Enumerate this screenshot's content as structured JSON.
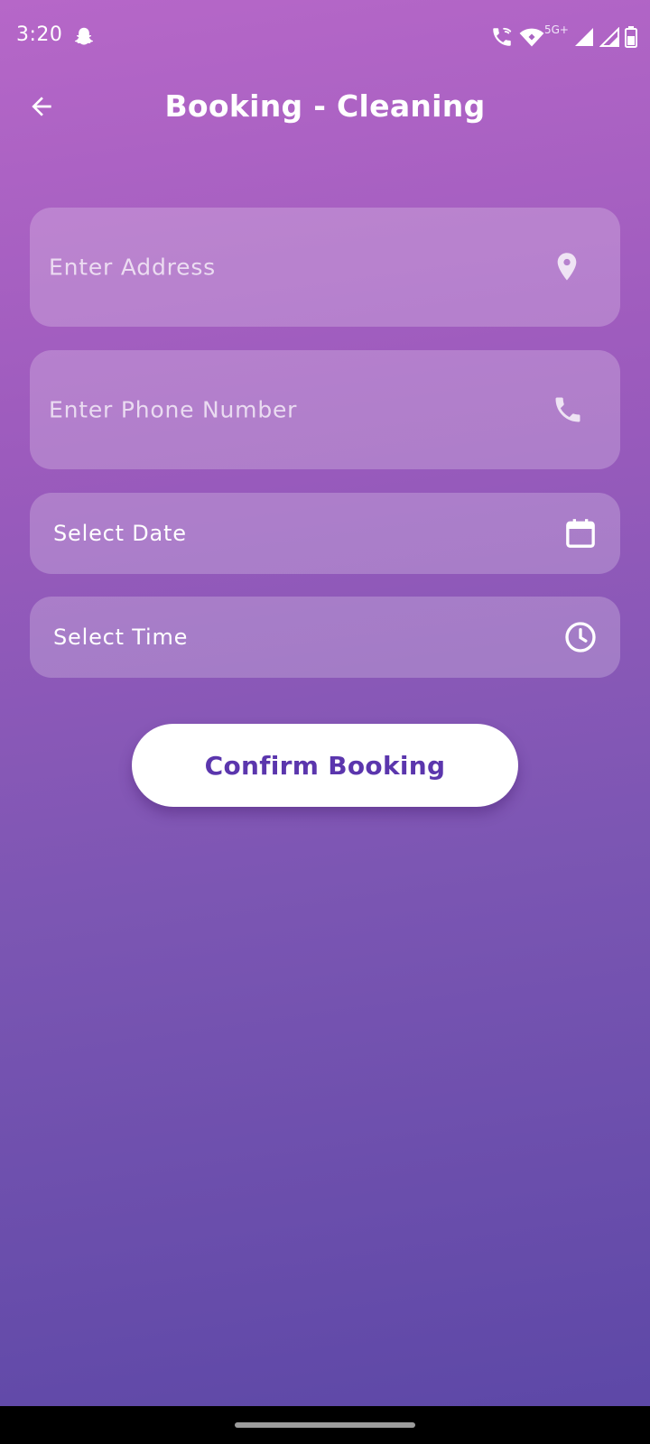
{
  "status_bar": {
    "time": "3:20",
    "network_label": "5G+",
    "icons": [
      "snapchat-ghost-icon",
      "wifi-calling-icon",
      "wifi-icon",
      "signal-icon",
      "signal-outline-icon",
      "battery-icon"
    ]
  },
  "app_bar": {
    "title": "Booking - Cleaning",
    "back_icon": "arrow-back-icon"
  },
  "form": {
    "address": {
      "placeholder": "Enter Address",
      "icon": "location-pin-icon"
    },
    "phone": {
      "placeholder": "Enter Phone Number",
      "icon": "phone-icon"
    },
    "date": {
      "label": "Select Date",
      "icon": "calendar-icon"
    },
    "time": {
      "label": "Select Time",
      "icon": "clock-icon"
    }
  },
  "confirm_button": {
    "label": "Confirm Booking"
  },
  "colors": {
    "gradient_top": "#b667c8",
    "gradient_bottom": "#5b47a6",
    "button_text": "#5b36ad",
    "button_bg": "#ffffff",
    "field_bg": "rgba(255,255,255,0.22)"
  }
}
